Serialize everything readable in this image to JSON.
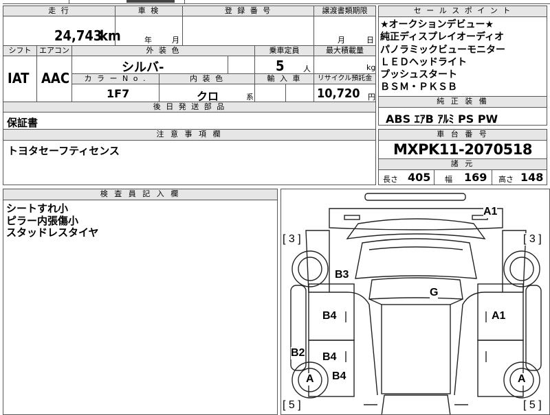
{
  "top_partial": "",
  "vehicle": {
    "mileage_label": "走 行",
    "mileage_value": "24,743",
    "mileage_unit": "km",
    "inspection_label": "車 検",
    "inspection_year_unit": "年",
    "inspection_month_unit": "月",
    "registration_label": "登 録 番 号",
    "transfer_label": "譲渡書類期限",
    "transfer_month": "月",
    "transfer_day": "日",
    "shift_label": "シフト",
    "shift_value": "IAT",
    "ac_label": "エアコン",
    "ac_value": "AAC",
    "exterior_color_label": "外 装 色",
    "exterior_color_value": "シルバ-",
    "color_no_label": "カ ラ ー N o .",
    "color_no_value": "1F7",
    "interior_color_label": "内 装 色",
    "interior_color_value": "クロ",
    "interior_suffix": "系",
    "capacity_label": "乗車定員",
    "capacity_value": "5",
    "capacity_unit": "人",
    "max_load_label": "最大積載量",
    "max_load_unit": "kg",
    "import_label": "輸 入 車",
    "recycle_label": "リサイクル預託金",
    "recycle_value": "10,720",
    "recycle_unit": "円"
  },
  "sales_points": {
    "label": "セ ー ル ス ポ イ ン ト",
    "lines": [
      "★オークションデビュー★",
      "純正ディスプレイオーディオ",
      "パノラミックビューモニター",
      "ＬＥＤヘッドライト",
      "プッシュスタート",
      "ＢＳＭ・ＰＫＳＢ"
    ]
  },
  "standard_equipment": {
    "label": "純 正 装 備",
    "value": "ABS ｴｱB ｱﾙﾐ PS PW"
  },
  "later_parts": {
    "label": "後 日 発 送 部 品",
    "value": "保証書"
  },
  "notes": {
    "label": "注 意 事 項 欄",
    "value": "トヨタセーフティセンス"
  },
  "chassis": {
    "label": "車 台 番 号",
    "value": "MXPK11-2070518"
  },
  "dimensions": {
    "label": "諸 元",
    "length_label": "長さ",
    "length_value": "405",
    "width_label": "幅",
    "width_value": "169",
    "height_label": "高さ",
    "height_value": "148"
  },
  "inspector": {
    "label": "検 査 員 記 入 欄",
    "lines": [
      "シートすれ小",
      "ピラー内張傷小",
      "スタッドレスタイヤ"
    ]
  },
  "diagram_marks": {
    "a1_top": "A1",
    "b3": "B3",
    "g": "G",
    "b4_upper": "B4",
    "a1_right": "A1",
    "b2": "B2",
    "b4_middle": "B4",
    "b4_lower": "B4",
    "a_left": "A",
    "a_right": "A",
    "tire_fl": "[ 3 ]",
    "tire_fr": "[ 3 ]",
    "tire_rl": "[ 5 ]",
    "tire_rr": "[ 5 ]"
  }
}
